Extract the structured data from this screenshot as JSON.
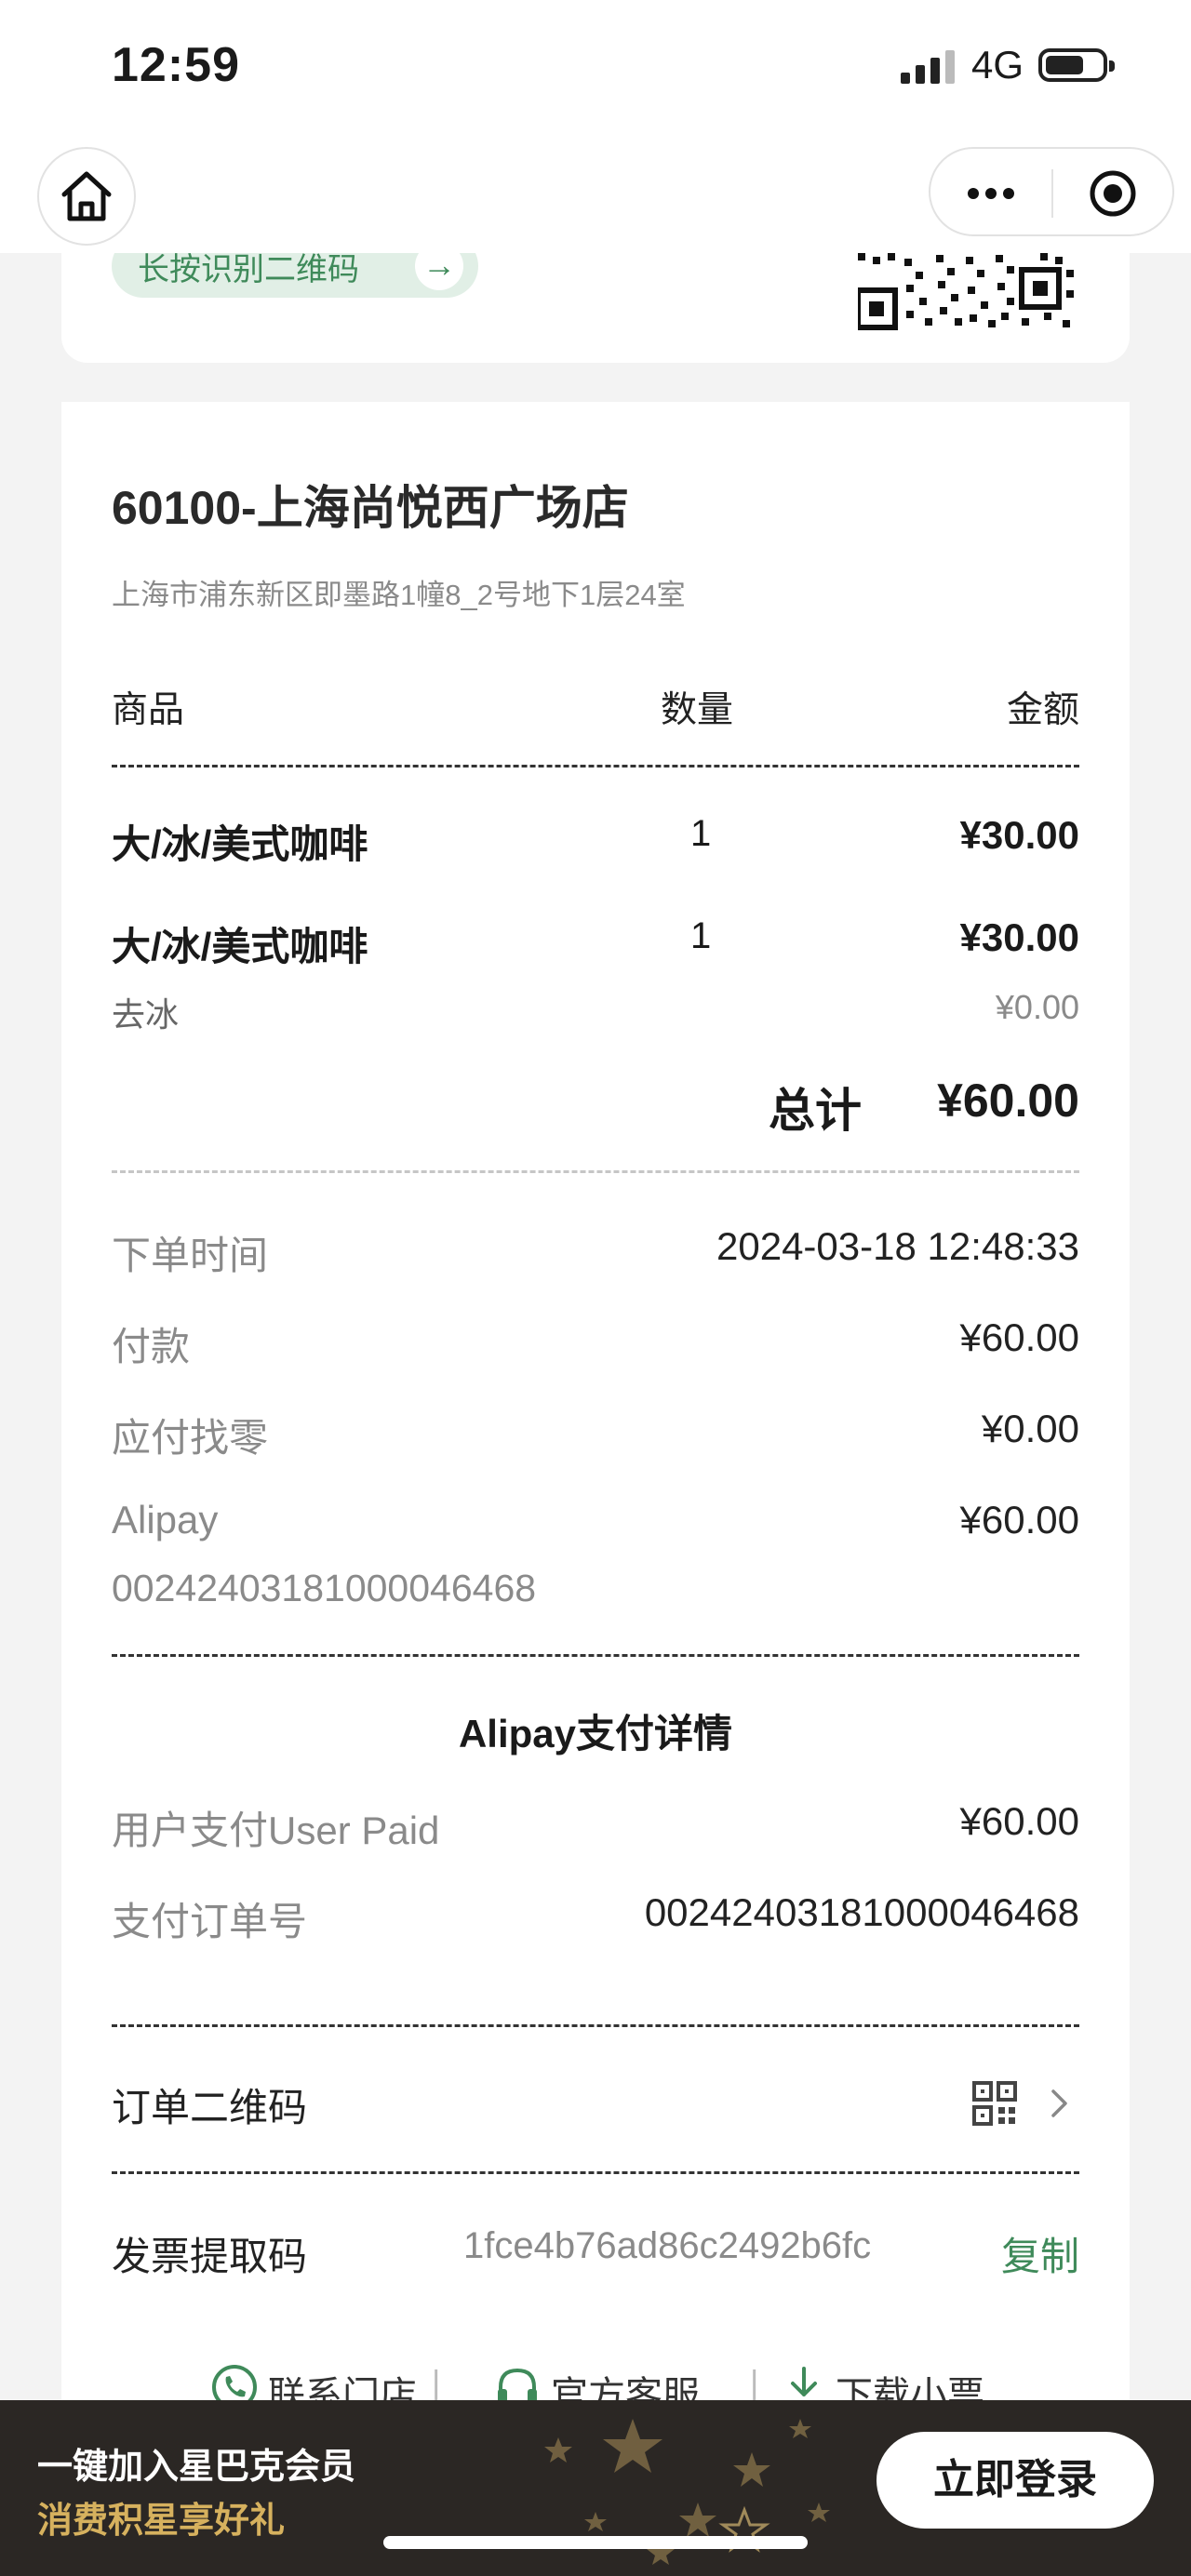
{
  "status_bar": {
    "time": "12:59",
    "network": "4G"
  },
  "top_card": {
    "scan_hint": "长按识别二维码"
  },
  "store": {
    "name": "60100-上海尚悦西广场店",
    "address": "上海市浦东新区即墨路1幢8_2号地下1层24室"
  },
  "table": {
    "headers": {
      "item": "商品",
      "qty": "数量",
      "amount": "金额"
    },
    "rows": [
      {
        "name": "大/冰/美式咖啡",
        "qty": "1",
        "amount": "¥30.00"
      },
      {
        "name": "大/冰/美式咖啡",
        "qty": "1",
        "amount": "¥30.00",
        "note": "去冰",
        "note_amount": "¥0.00"
      }
    ],
    "total_label": "总计",
    "total_value": "¥60.00"
  },
  "payment": {
    "order_time_label": "下单时间",
    "order_time": "2024-03-18 12:48:33",
    "pay_label": "付款",
    "pay_value": "¥60.00",
    "change_label": "应付找零",
    "change_value": "¥0.00",
    "method_label": "Alipay",
    "method_value": "¥60.00",
    "method_ref": "00242403181000046468"
  },
  "alipay_details": {
    "title": "Alipay支付详情",
    "user_paid_label": "用户支付User Paid",
    "user_paid_value": "¥60.00",
    "order_no_label": "支付订单号",
    "order_no_value": "00242403181000046468"
  },
  "order_qr": {
    "label": "订单二维码"
  },
  "invoice": {
    "label": "发票提取码",
    "code": "1fce4b76ad86c2492b6fc",
    "copy_label": "复制"
  },
  "footer_links": {
    "contact_store": "联系门店",
    "customer_service": "官方客服",
    "download_receipt": "下载小票"
  },
  "member_bar": {
    "line1": "一键加入星巴克会员",
    "line2": "消费积星享好礼",
    "login_label": "立即登录"
  },
  "colors": {
    "accent_green": "#3f8a5a",
    "member_gold": "#d6b15e",
    "member_bg": "#2b2724"
  }
}
